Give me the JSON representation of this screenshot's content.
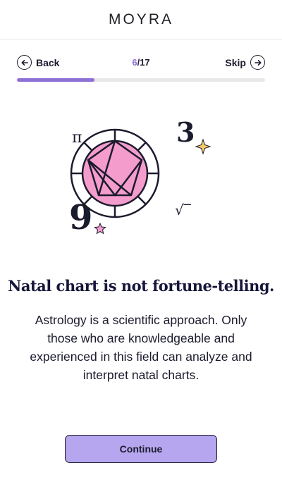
{
  "header": {
    "logo": "MOYRA"
  },
  "nav": {
    "back_label": "Back",
    "skip_label": "Skip",
    "step_current": "6",
    "step_total": "/17"
  },
  "progress": {
    "fraction": 0.313
  },
  "illustration": {
    "symbol_pi": "π",
    "number_three": "3",
    "number_nine": "9",
    "symbol_root": "√‾"
  },
  "content": {
    "title": "Natal chart is not fortune-telling.",
    "body": "Astrology is a scientific approach. Only those who are knowledgeable and experienced in this field can analyze and interpret natal charts."
  },
  "actions": {
    "continue_label": "Continue"
  },
  "colors": {
    "accent": "#8e6fd6",
    "button": "#b6a6ef",
    "wheel_fill": "#f49ccc",
    "star": "#f7c96b"
  }
}
